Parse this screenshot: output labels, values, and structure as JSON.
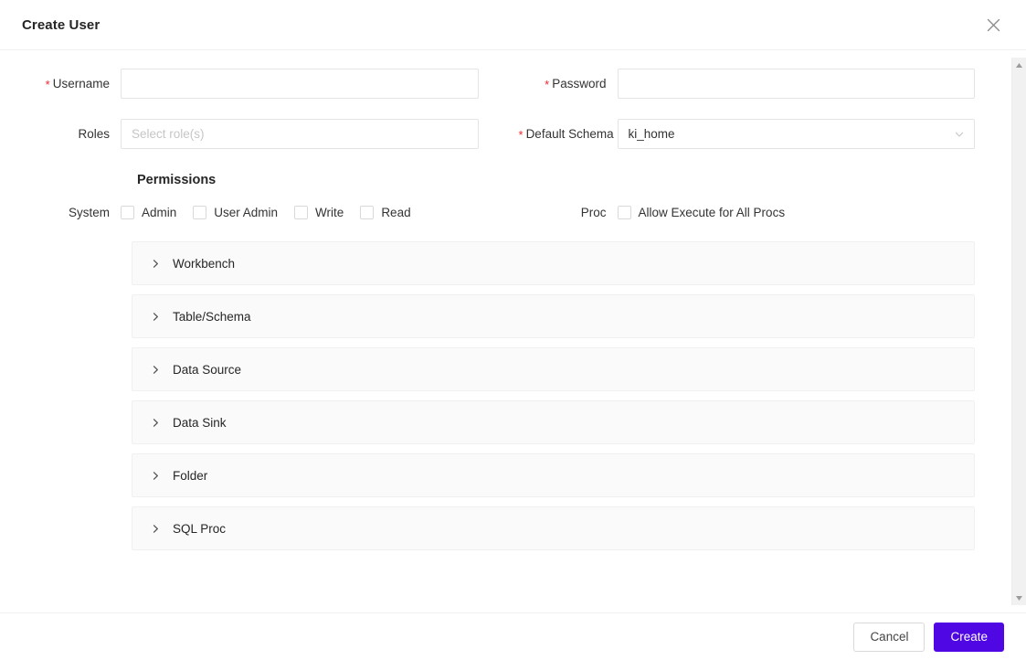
{
  "header": {
    "title": "Create User",
    "close_icon": "close-icon"
  },
  "form": {
    "username": {
      "label": "Username",
      "required": true,
      "value": "",
      "placeholder": ""
    },
    "password": {
      "label": "Password",
      "required": true,
      "value": "",
      "placeholder": ""
    },
    "roles": {
      "label": "Roles",
      "required": false,
      "value": "",
      "placeholder": "Select role(s)"
    },
    "default_schema": {
      "label": "Default Schema",
      "required": true,
      "value": "ki_home",
      "chevron_icon": "chevron-down-icon"
    }
  },
  "permissions": {
    "title": "Permissions",
    "system": {
      "label": "System",
      "checkboxes": [
        {
          "label": "Admin",
          "checked": false
        },
        {
          "label": "User Admin",
          "checked": false
        },
        {
          "label": "Write",
          "checked": false
        },
        {
          "label": "Read",
          "checked": false
        }
      ]
    },
    "proc": {
      "label": "Proc",
      "checkboxes": [
        {
          "label": "Allow Execute for All Procs",
          "checked": false
        }
      ]
    },
    "panels": [
      {
        "label": "Workbench",
        "expanded": false,
        "icon": "chevron-right-icon"
      },
      {
        "label": "Table/Schema",
        "expanded": false,
        "icon": "chevron-right-icon"
      },
      {
        "label": "Data Source",
        "expanded": false,
        "icon": "chevron-right-icon"
      },
      {
        "label": "Data Sink",
        "expanded": false,
        "icon": "chevron-right-icon"
      },
      {
        "label": "Folder",
        "expanded": false,
        "icon": "chevron-right-icon"
      },
      {
        "label": "SQL Proc",
        "expanded": false,
        "icon": "chevron-right-icon"
      }
    ]
  },
  "scrollbar": {
    "up_icon": "scroll-up-arrow-icon",
    "down_icon": "scroll-down-arrow-icon"
  },
  "footer": {
    "cancel_label": "Cancel",
    "create_label": "Create"
  },
  "colors": {
    "primary": "#4f07e4",
    "required_star": "#f5222d",
    "panel_bg": "#fafafa",
    "border": "#e4e4e4",
    "text": "#333333",
    "placeholder": "#c6c6c6"
  }
}
